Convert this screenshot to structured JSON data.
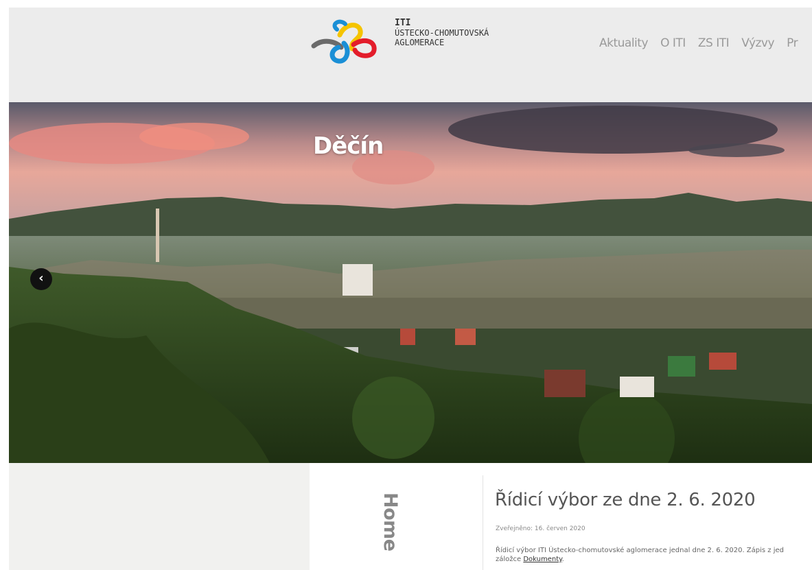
{
  "header": {
    "logo_lines": [
      "ITI",
      "ÚSTECKO-CHOMUTOVSKÁ",
      "AGLOMERACE"
    ],
    "nav": [
      "Aktuality",
      "O ITI",
      "ZS ITI",
      "Výzvy",
      "Pr"
    ]
  },
  "hero": {
    "title": "Děčín",
    "prev_icon": "chevron-left-icon"
  },
  "content": {
    "sidebar_title": "Home",
    "article": {
      "title": "Řídicí výbor ze dne 2. 6. 2020",
      "published": "Zveřejněno: 16. červen 2020",
      "excerpt_line1": "Řídicí výbor ITI Ústecko-chomutovské aglomerace jednal dne 2. 6. 2020. Zápis z jed",
      "excerpt_line2_prefix": "záložce ",
      "excerpt_link": "Dokumenty",
      "excerpt_line2_suffix": "."
    }
  },
  "colors": {
    "header_bg": "#ececec",
    "logo_blue": "#1a8fd6",
    "logo_red": "#e31d2b",
    "logo_yellow": "#f5c400",
    "logo_grey": "#6b6b6b"
  }
}
